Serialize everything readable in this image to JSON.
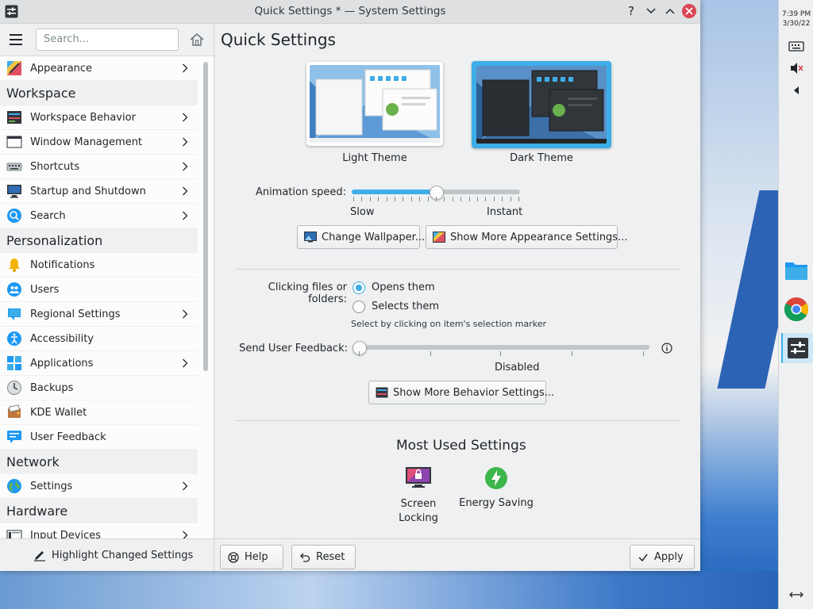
{
  "window": {
    "title": "Quick Settings * — System Settings",
    "buttons": [
      "help-icon",
      "minimize-icon",
      "maximize-icon",
      "close-icon"
    ]
  },
  "sidebar": {
    "search_placeholder": "Search...",
    "items": [
      {
        "type": "item",
        "label": "Appearance",
        "icon": "appearance-icon",
        "chevron": true
      },
      {
        "type": "category",
        "label": "Workspace"
      },
      {
        "type": "item",
        "label": "Workspace Behavior",
        "icon": "workspace-icon",
        "chevron": true
      },
      {
        "type": "item",
        "label": "Window Management",
        "icon": "window-icon",
        "chevron": true
      },
      {
        "type": "item",
        "label": "Shortcuts",
        "icon": "keyboard-icon",
        "chevron": true
      },
      {
        "type": "item",
        "label": "Startup and Shutdown",
        "icon": "monitor-icon",
        "chevron": true
      },
      {
        "type": "item",
        "label": "Search",
        "icon": "search-icon",
        "chevron": true
      },
      {
        "type": "category",
        "label": "Personalization"
      },
      {
        "type": "item",
        "label": "Notifications",
        "icon": "bell-icon",
        "chevron": false
      },
      {
        "type": "item",
        "label": "Users",
        "icon": "users-icon",
        "chevron": false
      },
      {
        "type": "item",
        "label": "Regional Settings",
        "icon": "flag-icon",
        "chevron": true
      },
      {
        "type": "item",
        "label": "Accessibility",
        "icon": "accessibility-icon",
        "chevron": false
      },
      {
        "type": "item",
        "label": "Applications",
        "icon": "applications-icon",
        "chevron": true
      },
      {
        "type": "item",
        "label": "Backups",
        "icon": "backup-icon",
        "chevron": false
      },
      {
        "type": "item",
        "label": "KDE Wallet",
        "icon": "wallet-icon",
        "chevron": false
      },
      {
        "type": "item",
        "label": "User Feedback",
        "icon": "feedback-icon",
        "chevron": false
      },
      {
        "type": "category",
        "label": "Network"
      },
      {
        "type": "item",
        "label": "Settings",
        "icon": "globe-icon",
        "chevron": true
      },
      {
        "type": "category",
        "label": "Hardware"
      },
      {
        "type": "item",
        "label": "Input Devices",
        "icon": "input-devices-icon",
        "chevron": true
      }
    ],
    "highlight_changed_label": "Highlight Changed Settings"
  },
  "main": {
    "title": "Quick Settings",
    "themes": [
      {
        "label": "Light Theme",
        "selected": false
      },
      {
        "label": "Dark Theme",
        "selected": true
      }
    ],
    "animation": {
      "label": "Animation speed:",
      "min_label": "Slow",
      "max_label": "Instant",
      "value": 0.5
    },
    "change_wallpaper_label": "Change Wallpaper...",
    "more_appearance_label": "Show More Appearance Settings...",
    "clicking": {
      "label": "Clicking files or folders:",
      "options": [
        "Opens them",
        "Selects them"
      ],
      "selected": "Opens them",
      "hint": "Select by clicking on item's selection marker"
    },
    "feedback": {
      "label": "Send User Feedback:",
      "value_label": "Disabled",
      "value": 0
    },
    "more_behavior_label": "Show More Behavior Settings...",
    "most_used": {
      "title": "Most Used Settings",
      "items": [
        {
          "label": "Screen Locking",
          "icon": "screen-lock-icon"
        },
        {
          "label": "Energy Saving",
          "icon": "energy-icon"
        }
      ]
    },
    "footer": {
      "help_label": "Help",
      "reset_label": "Reset",
      "apply_label": "Apply"
    }
  },
  "panel": {
    "time": "7:39 PM",
    "date": "3/30/22"
  },
  "colors": {
    "accent": "#3daee9",
    "window_bg": "#eff0f1",
    "close": "#da4453"
  }
}
